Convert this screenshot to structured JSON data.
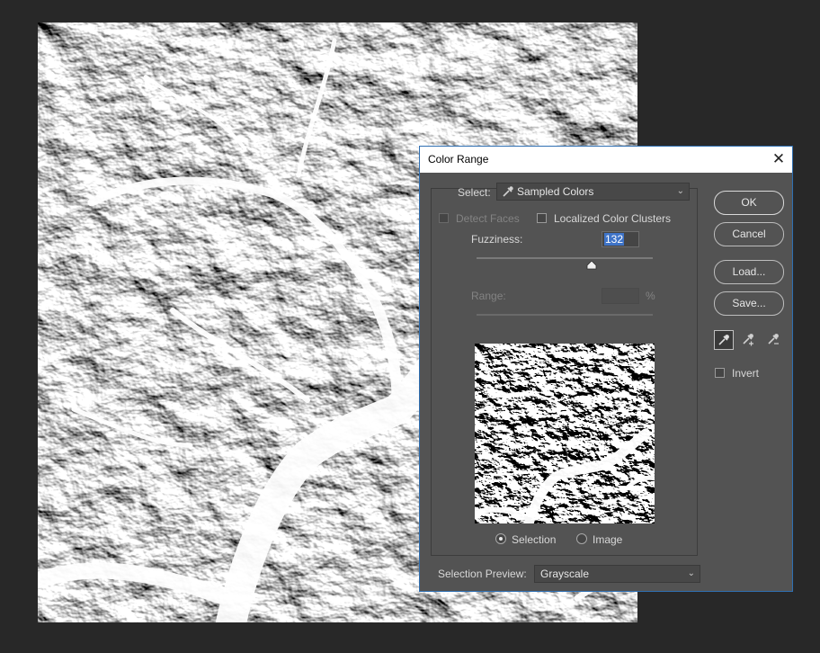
{
  "dialog": {
    "title": "Color Range",
    "close_glyph": "✕",
    "select_label": "Select:",
    "select_value": "Sampled Colors",
    "detect_faces_label": "Detect Faces",
    "detect_faces_checked": false,
    "localized_label": "Localized Color Clusters",
    "localized_checked": false,
    "fuzziness_label": "Fuzziness:",
    "fuzziness_value": "132",
    "fuzziness_slider_fraction": 0.66,
    "range_label": "Range:",
    "range_value": "",
    "range_unit": "%",
    "view_options": [
      {
        "label": "Selection",
        "selected": true
      },
      {
        "label": "Image",
        "selected": false
      }
    ],
    "selection_preview_label": "Selection Preview:",
    "selection_preview_value": "Grayscale",
    "buttons": {
      "ok": "OK",
      "cancel": "Cancel",
      "load": "Load...",
      "save": "Save..."
    },
    "eyedroppers": [
      {
        "icon": "eyedropper-icon",
        "active": true
      },
      {
        "icon": "eyedropper-plus-icon",
        "active": false
      },
      {
        "icon": "eyedropper-minus-icon",
        "active": false
      }
    ],
    "invert_label": "Invert",
    "invert_checked": false
  },
  "colors": {
    "workspace": "#282828",
    "dialog_bg": "#535353",
    "dialog_border": "#2f6fb2",
    "highlight": "#3f74c8"
  }
}
